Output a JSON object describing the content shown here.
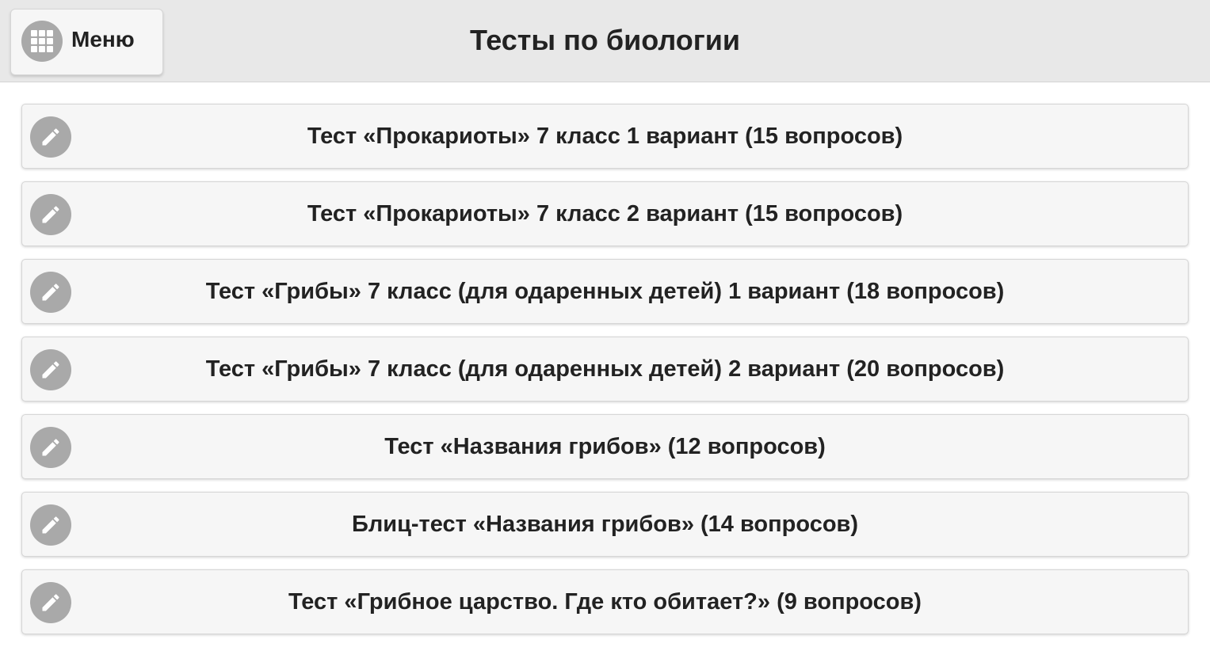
{
  "header": {
    "title": "Тесты по биологии",
    "menu_label": "Меню",
    "menu_icon": "grid-icon"
  },
  "colors": {
    "header_bg": "#e8e8e8",
    "item_bg": "#f6f6f6",
    "icon_bg": "#a9a9a9",
    "text": "#222222"
  },
  "tests": [
    {
      "label": "Тест «Прокариоты» 7 класс 1 вариант (15 вопросов)",
      "icon": "pencil-icon"
    },
    {
      "label": "Тест «Прокариоты» 7 класс 2 вариант (15 вопросов)",
      "icon": "pencil-icon"
    },
    {
      "label": "Тест «Грибы» 7 класс (для одаренных детей) 1 вариант (18 вопросов)",
      "icon": "pencil-icon"
    },
    {
      "label": "Тест «Грибы» 7 класс (для одаренных детей) 2 вариант (20 вопросов)",
      "icon": "pencil-icon"
    },
    {
      "label": "Тест «Названия грибов» (12 вопросов)",
      "icon": "pencil-icon"
    },
    {
      "label": "Блиц-тест «Названия грибов» (14 вопросов)",
      "icon": "pencil-icon"
    },
    {
      "label": "Тест «Грибное царство. Где кто обитает?» (9 вопросов)",
      "icon": "pencil-icon"
    }
  ]
}
